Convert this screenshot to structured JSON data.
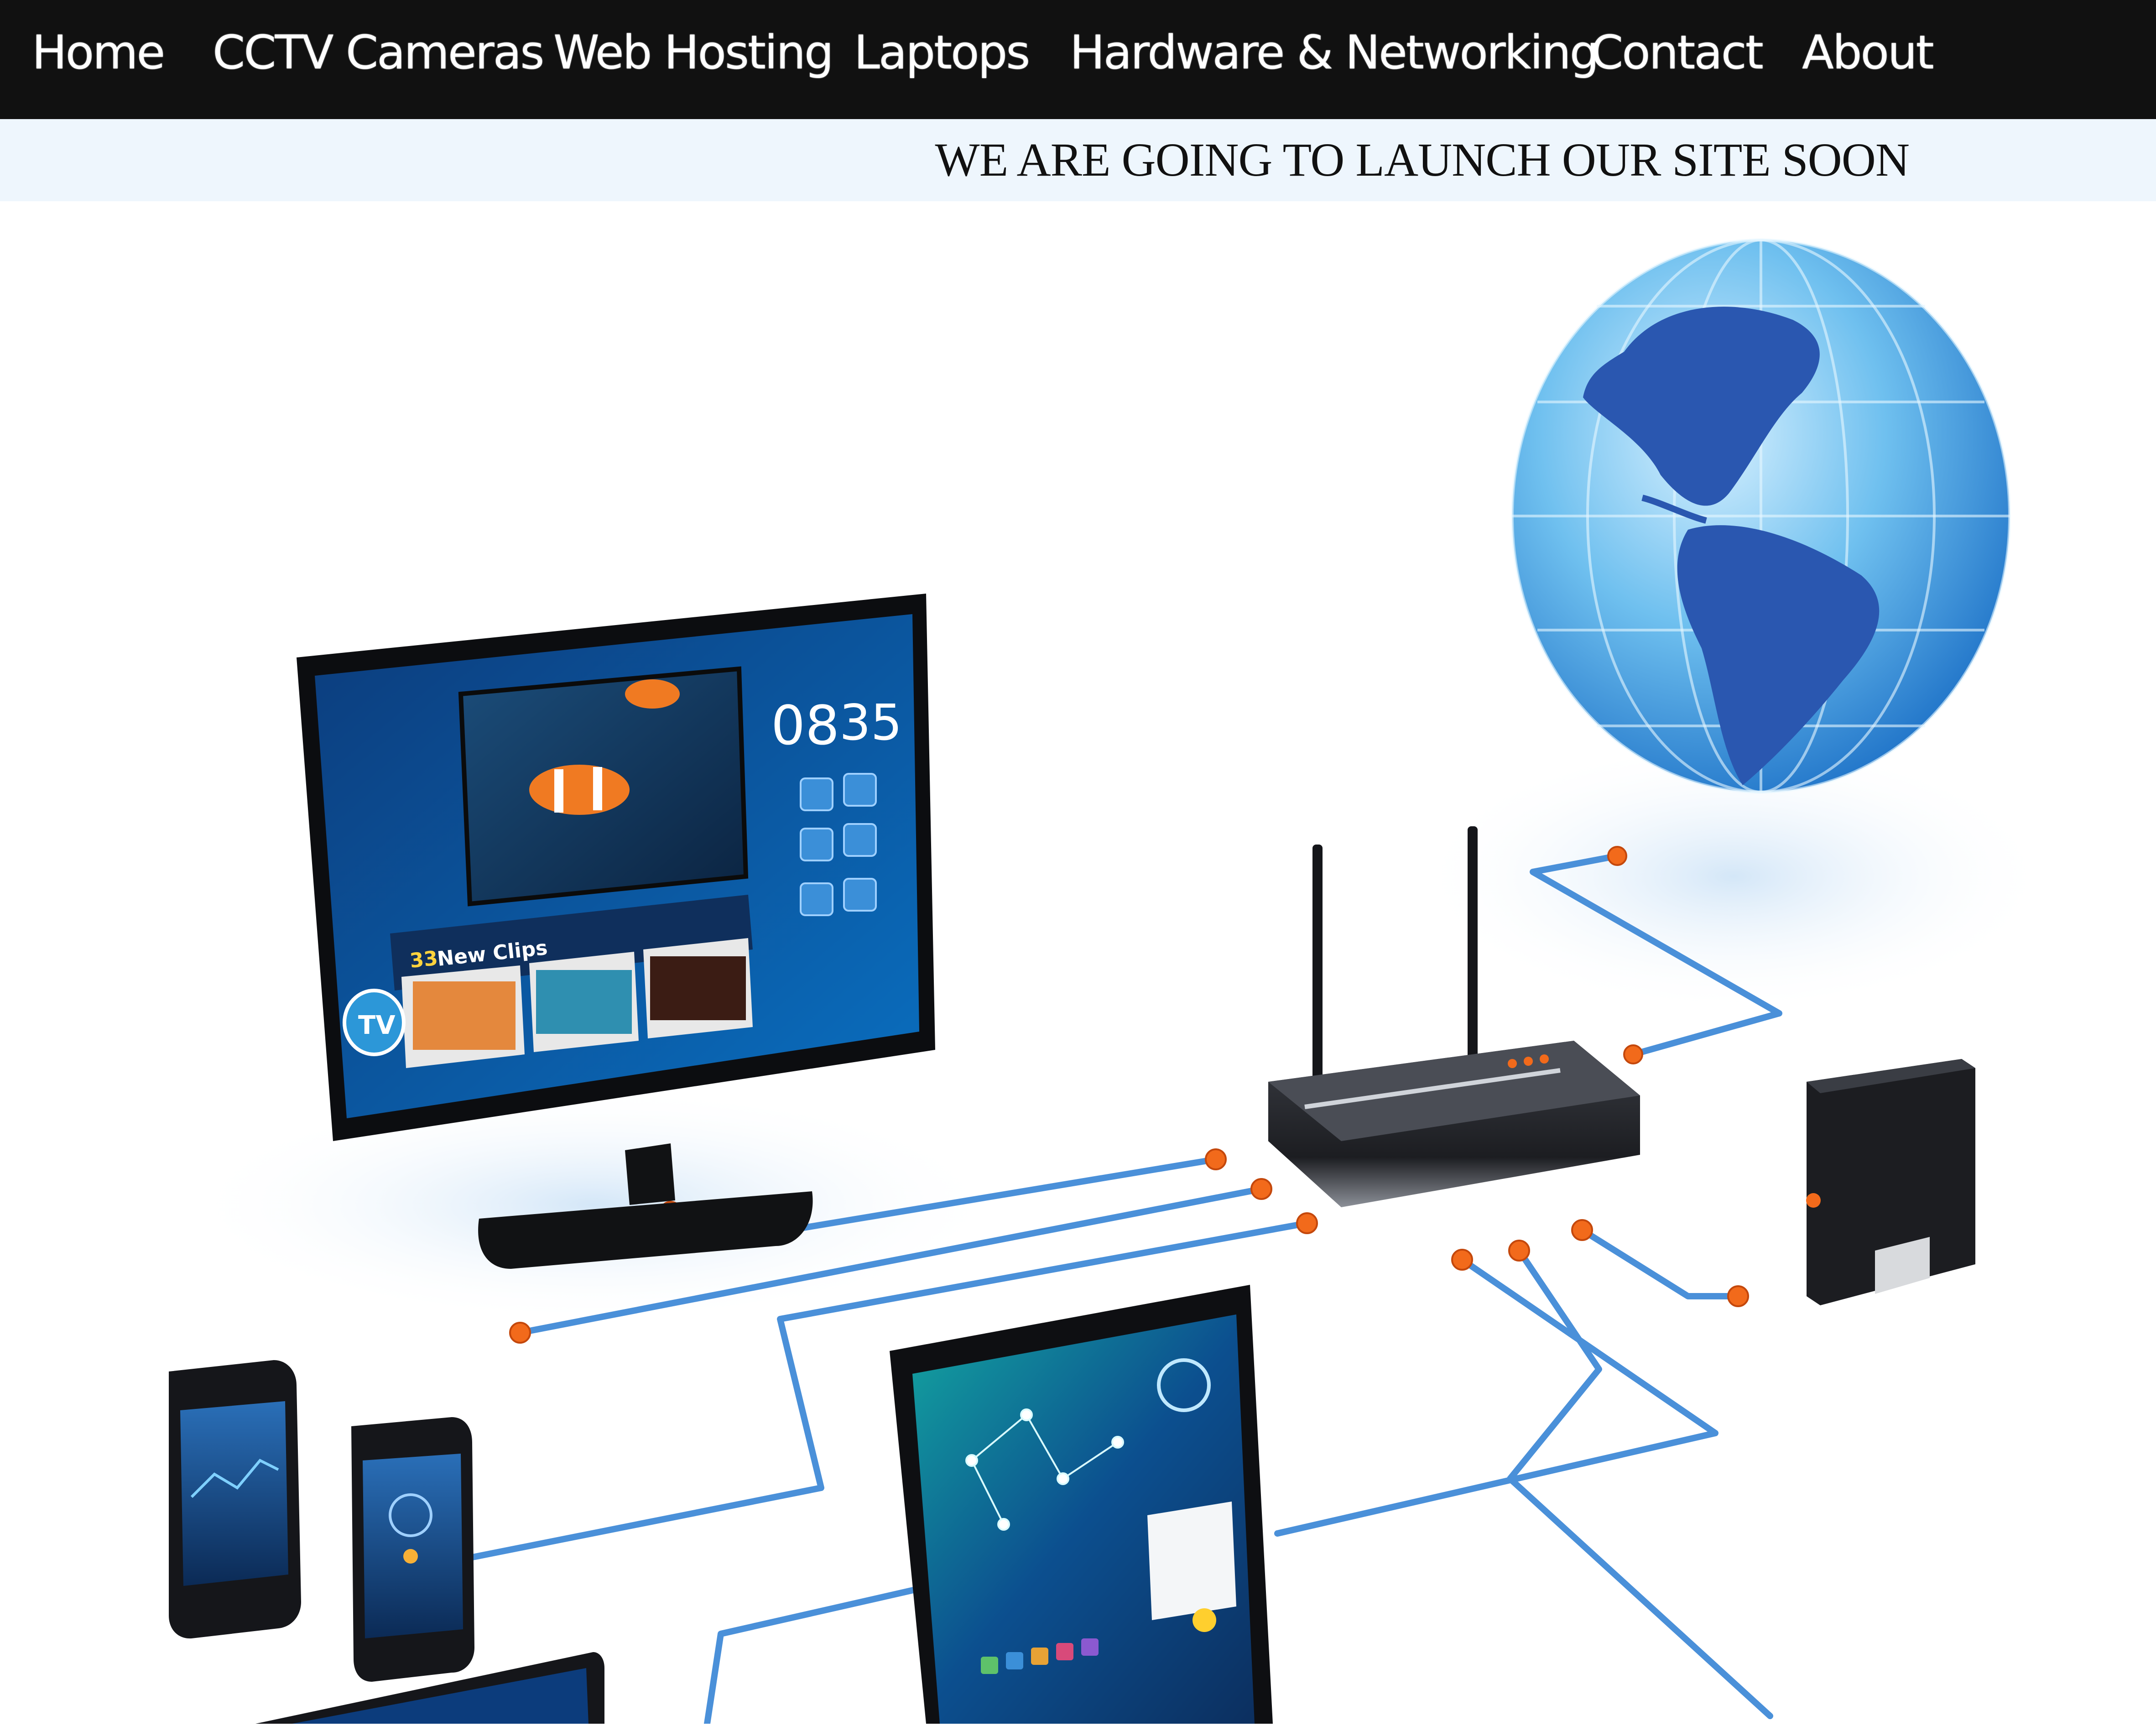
{
  "nav": {
    "items": [
      {
        "label": "Home"
      },
      {
        "label": "CCTV Cameras"
      },
      {
        "label": "Web Hosting"
      },
      {
        "label": "Laptops"
      },
      {
        "label": "Hardware & Networking"
      },
      {
        "label": "Contact"
      },
      {
        "label": "About"
      }
    ]
  },
  "banner": {
    "text": "WE ARE GOING TO LAUNCH OUR SITE SOON"
  },
  "hero": {
    "tv": {
      "time_hours": "08",
      "time_minutes": "35",
      "clips_count": "33",
      "clips_label": "New Clips",
      "tv_badge": "TV"
    }
  },
  "colors": {
    "nav_bg": "#111111",
    "banner_bg": "#eef6fd",
    "cable": "#4a90d9",
    "connector": "#f26a1b",
    "globe": "#2f7fd6"
  }
}
